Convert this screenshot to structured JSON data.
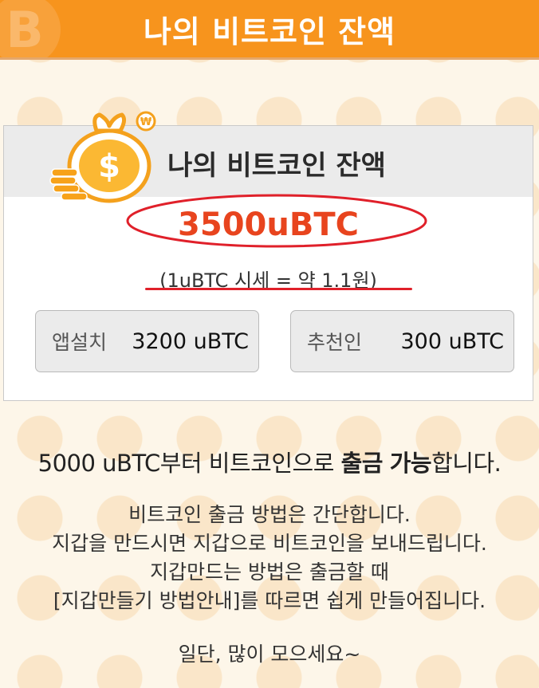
{
  "header": {
    "title": "나의 비트코인 잔액",
    "logo_icon": "bitcoin-icon"
  },
  "card": {
    "title": "나의 비트코인 잔액",
    "icon": "money-bag-icon",
    "balance": "3500uBTC",
    "rate": "(1uBTC 시세 = 약 1.1원)",
    "stats": [
      {
        "label": "앱설치",
        "value": "3200 uBTC"
      },
      {
        "label": "추천인",
        "value": "300 uBTC"
      }
    ]
  },
  "notice": {
    "amount": "5000 uBTC",
    "mid": "부터 비트코인으로 ",
    "strong1": "출금",
    "space": " ",
    "strong2": "가능",
    "end": "합니다."
  },
  "guide": {
    "lines": [
      "비트코인 출금 방법은 간단합니다.",
      "지갑을 만드시면 지갑으로 비트코인을 보내드립니다.",
      "지갑만드는 방법은 출금할 때",
      "[지갑만들기 방법안내]를 따르면 쉽게 만들어집니다."
    ],
    "closing": "일단, 많이 모으세요~"
  },
  "colors": {
    "header": "#f7941d",
    "balance": "#e8441e",
    "annotation_red": "#e0202a",
    "background": "#fdf6e9"
  }
}
